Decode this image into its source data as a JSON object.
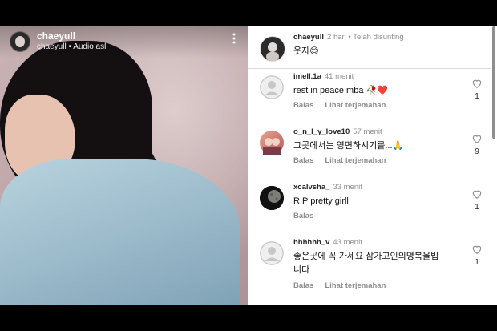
{
  "post": {
    "username": "chaeyull",
    "subtitle": "chaeyull • Audio asli"
  },
  "caption": {
    "username": "chaeyull",
    "time": "2 hari • Telah disunting",
    "text": "웃자😊"
  },
  "comments": [
    {
      "username": "imell.1a",
      "time": "41 menit",
      "text": "rest in peace mba 🥀❤️",
      "reply": "Balas",
      "translate": "Lihat terjemahan",
      "likes": "1",
      "avatar": "default"
    },
    {
      "username": "o_n_l_y_love10",
      "time": "57 menit",
      "text": "그곳에서는 영면하시기를...🙏",
      "reply": "Balas",
      "translate": "Lihat terjemahan",
      "likes": "9",
      "avatar": "photo"
    },
    {
      "username": "xcalvsha_",
      "time": "33 menit",
      "text": "RIP pretty girll",
      "reply": "Balas",
      "translate": "",
      "likes": "1",
      "avatar": "moon"
    },
    {
      "username": "hhhhhh_v",
      "time": "43 menit",
      "text_line1": "좋은곳에 꼭 가세요 삼가고인의명복을빕",
      "text_line2": "니다",
      "reply": "Balas",
      "translate": "Lihat terjemahan",
      "likes": "1",
      "avatar": "default"
    }
  ],
  "icons": {
    "more": "more-vertical-icon",
    "like": "heart-outline-icon"
  }
}
